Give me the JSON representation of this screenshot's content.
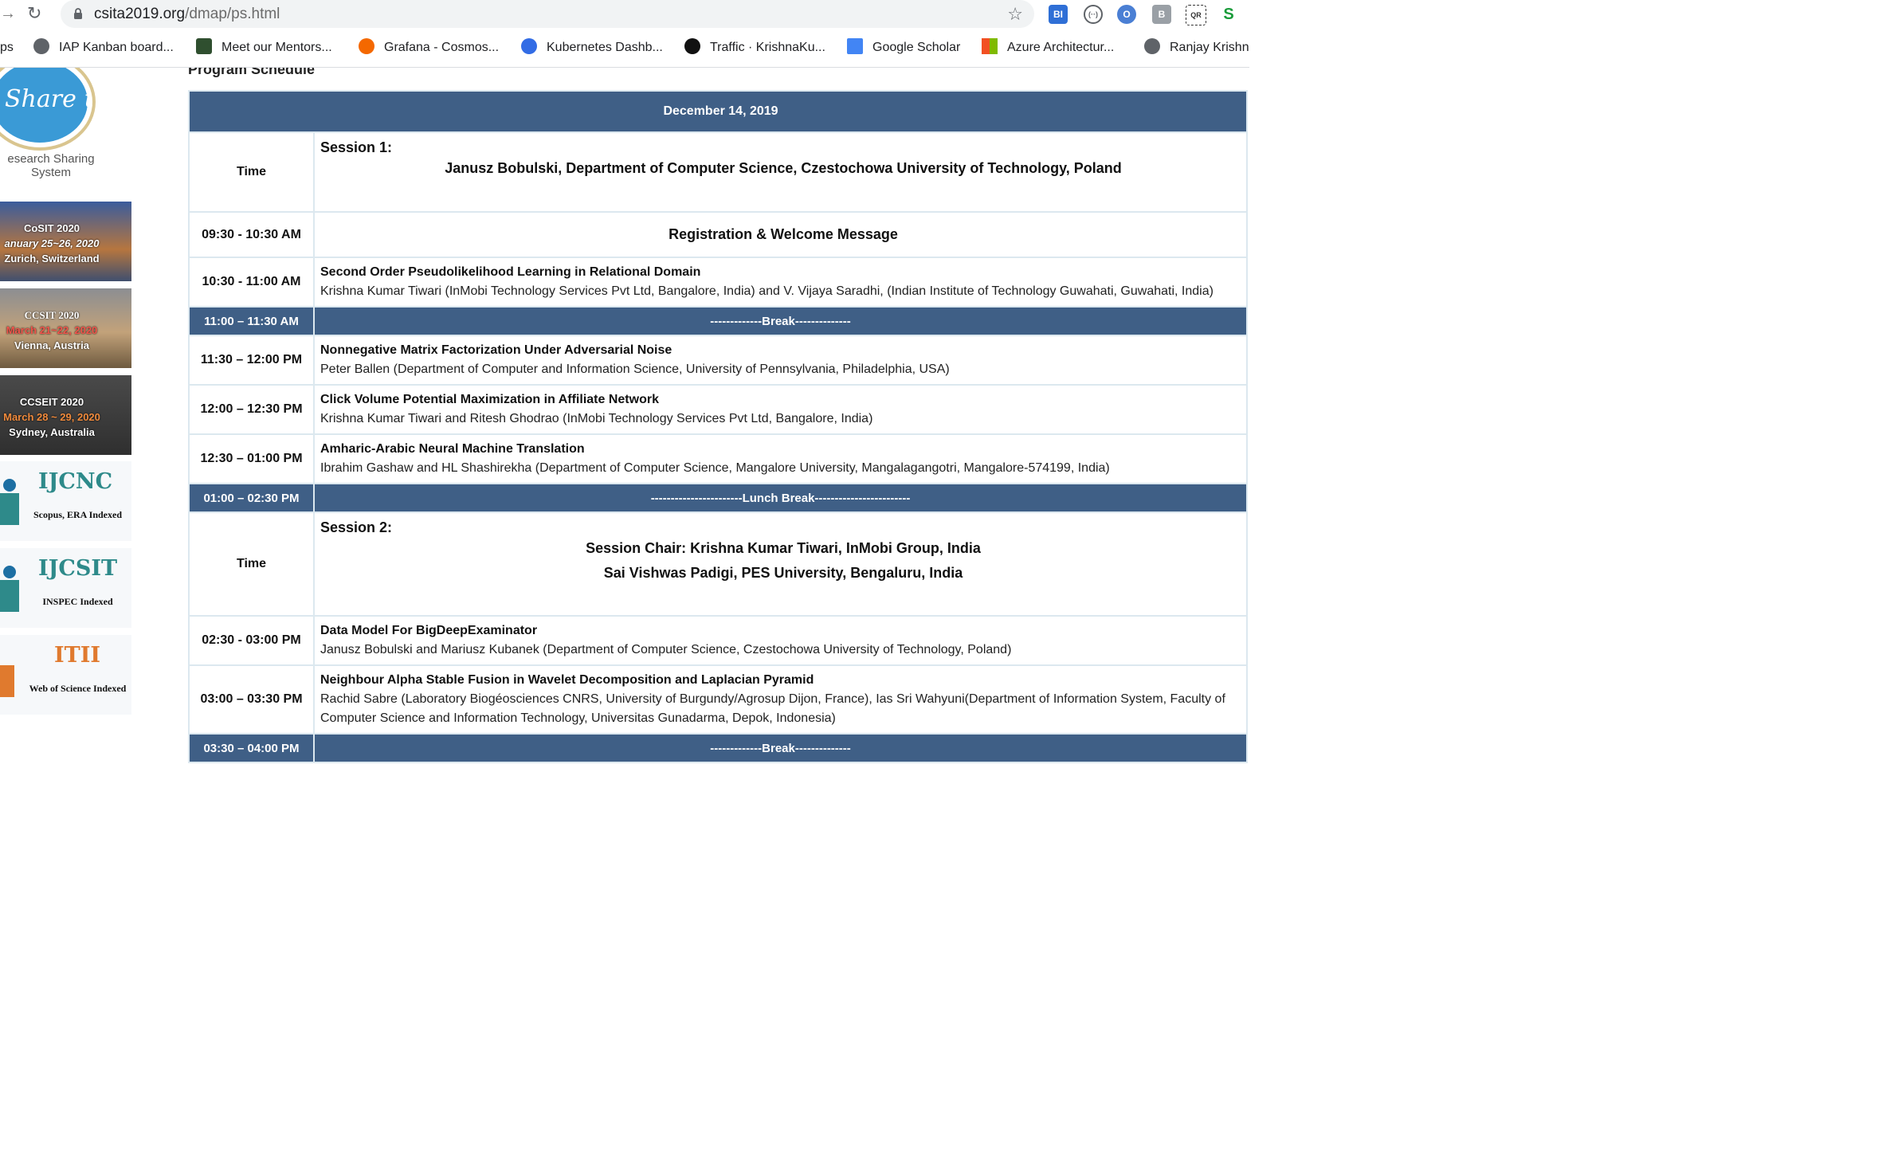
{
  "browser": {
    "url_domain": "csita2019.org",
    "url_path": "/dmap/ps.html",
    "bookmarks": [
      {
        "label": "ps",
        "color": "#5f6368"
      },
      {
        "label": "IAP Kanban board...",
        "color": "#5f6368"
      },
      {
        "label": "Meet our Mentors...",
        "color": "#2f4f2f"
      },
      {
        "label": "Grafana - Cosmos...",
        "color": "#f46800"
      },
      {
        "label": "Kubernetes Dashb...",
        "color": "#326ce5"
      },
      {
        "label": "Traffic · KrishnaKu...",
        "color": "#111111"
      },
      {
        "label": "Google Scholar",
        "color": "#4285f4"
      },
      {
        "label": "Azure Architectur...",
        "color": "#f25022"
      },
      {
        "label": "Ranjay Krishn",
        "color": "#5f6368"
      }
    ],
    "extensions": [
      "BI",
      "(··)",
      "O",
      "B",
      "QR",
      "S"
    ]
  },
  "sidebar": {
    "share_logo_text": "Share url",
    "share_caption_1": "esearch Sharing",
    "share_caption_2": "System",
    "ads": [
      {
        "title": "CoSIT 2020",
        "date": "anuary 25~26, 2020",
        "place": "Zurich, Switzerland"
      },
      {
        "title": "CCSIT 2020",
        "date": "March 21~22, 2020",
        "place": "Vienna, Austria"
      },
      {
        "title": "CCSEIT 2020",
        "date": "March 28 ~ 29, 2020",
        "place": "Sydney, Australia"
      }
    ],
    "journals": [
      {
        "name": "IJCNC",
        "sub": "Scopus, ERA Indexed",
        "color": "#2e8a8a"
      },
      {
        "name": "IJCSIT",
        "sub": "INSPEC Indexed",
        "color": "#2e8a8a"
      },
      {
        "name": "ITII",
        "sub": "Web of Science Indexed",
        "color": "#e07a2e"
      }
    ]
  },
  "page": {
    "heading": "Program Schedule",
    "date_header": "December 14, 2019",
    "session1": {
      "time_label": "Time",
      "label": "Session 1:",
      "chair": "Janusz Bobulski, Department of Computer Science, Czestochowa University of Technology, Poland"
    },
    "welcome": {
      "time": "09:30 - 10:30 AM",
      "text": "Registration & Welcome Message"
    },
    "rows_a": [
      {
        "time": "10:30 - 11:00 AM",
        "title": "Second Order Pseudolikelihood Learning in Relational Domain",
        "authors": "Krishna Kumar Tiwari (InMobi Technology Services Pvt Ltd, Bangalore, India) and V. Vijaya Saradhi, (Indian Institute of Technology Guwahati, Guwahati, India)"
      }
    ],
    "break1": {
      "time": "11:00 – 11:30 AM",
      "text": "-------------Break--------------"
    },
    "rows_b": [
      {
        "time": "11:30 – 12:00 PM",
        "title": "Nonnegative Matrix Factorization Under Adversarial Noise",
        "authors": "Peter Ballen (Department of Computer and Information Science, University of Pennsylvania, Philadelphia, USA)"
      },
      {
        "time": "12:00 – 12:30 PM",
        "title": "Click Volume Potential Maximization in Affiliate Network",
        "authors": "Krishna Kumar Tiwari and Ritesh Ghodrao (InMobi Technology Services Pvt Ltd, Bangalore, India)"
      },
      {
        "time": "12:30 – 01:00 PM",
        "title": "Amharic-Arabic Neural Machine Translation",
        "authors": "Ibrahim Gashaw and HL Shashirekha (Department of Computer Science, Mangalore University, Mangalagangotri, Mangalore-574199, India)"
      }
    ],
    "lunch": {
      "time": "01:00 – 02:30 PM",
      "text": "-----------------------Lunch Break------------------------"
    },
    "session2": {
      "time_label": "Time",
      "label": "Session 2:",
      "chair_1": "Session Chair: Krishna Kumar Tiwari, InMobi Group, India",
      "chair_2": "Sai Vishwas Padigi, PES University, Bengaluru, India"
    },
    "rows_c": [
      {
        "time": "02:30 - 03:00 PM",
        "title": "Data Model For BigDeepExaminator",
        "authors": "Janusz Bobulski and Mariusz Kubanek (Department of Computer Science, Czestochowa University of Technology, Poland)"
      },
      {
        "time": "03:00 – 03:30 PM",
        "title": "Neighbour Alpha Stable Fusion in Wavelet Decomposition and Laplacian Pyramid",
        "authors": "Rachid Sabre (Laboratory Biogéosciences CNRS, University of Burgundy/Agrosup Dijon, France), Ias Sri Wahyuni(Department of Information System, Faculty of Computer Science and Information Technology, Universitas Gunadarma, Depok, Indonesia)"
      }
    ],
    "break2": {
      "time": "03:30 – 04:00 PM",
      "text": "-------------Break--------------"
    }
  }
}
